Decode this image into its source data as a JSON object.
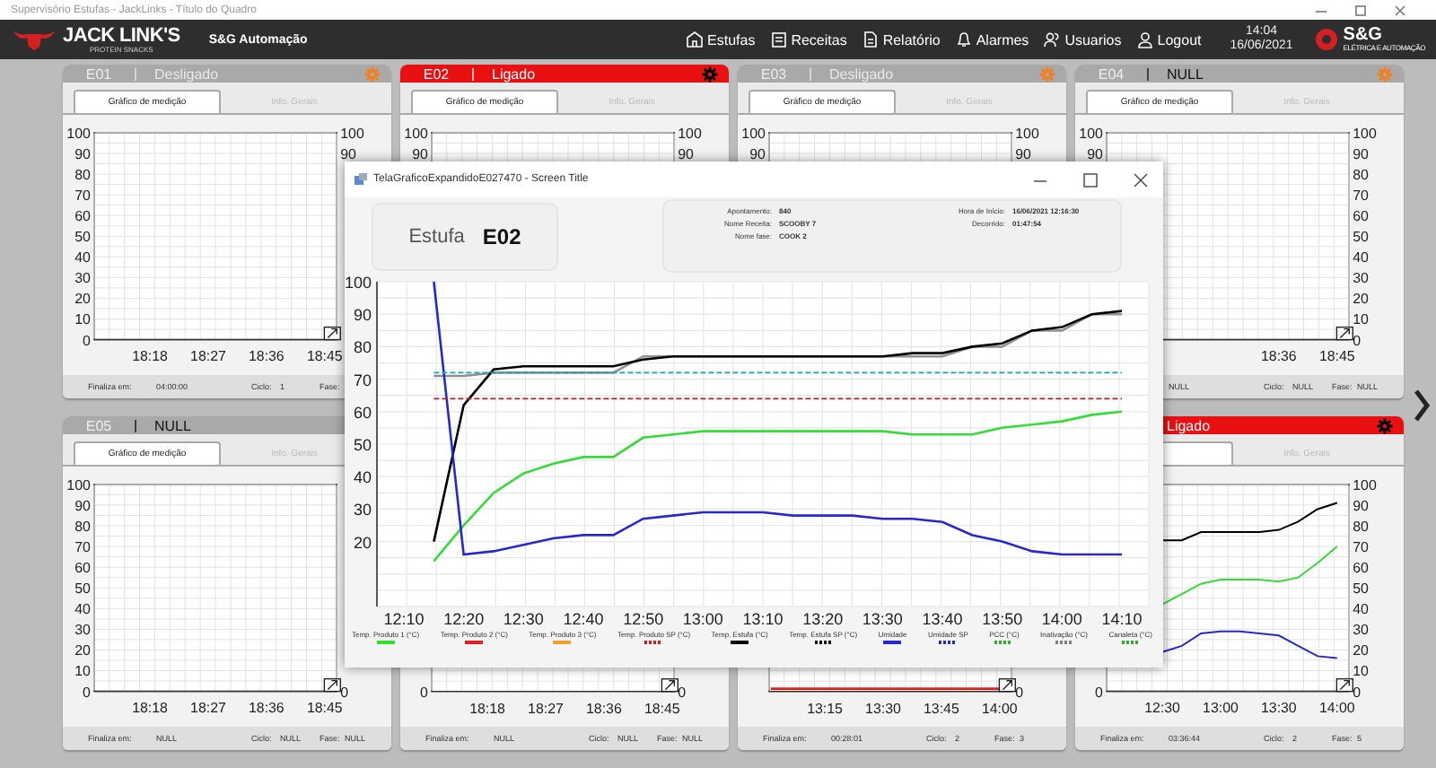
{
  "title_bar": {
    "title": "Supervisório Estufas - JackLinks - Título do Quadro"
  },
  "header": {
    "brand": "JACK LINK'S",
    "brand_tagline": "PROTEIN SNACKS",
    "company": "S&G Automação",
    "nav": [
      {
        "label": "Estufas"
      },
      {
        "label": "Receitas"
      },
      {
        "label": "Relatório"
      },
      {
        "label": "Alarmes"
      },
      {
        "label": "Usuarios"
      },
      {
        "label": "Logout"
      }
    ],
    "time": "14:04",
    "date": "16/06/2021",
    "partner": "S&G",
    "partner_tagline": "ELÉTRICA E AUTOMAÇÃO"
  },
  "cards": [
    {
      "code": "E01",
      "status": "Desligado",
      "kind": "off",
      "settings_icon": true,
      "tabs": [
        {
          "label": "Gráfico de medição",
          "selected": true
        },
        {
          "label": "Info. Gerais",
          "selected": false
        }
      ],
      "left_axis": {
        "upper_labels": [
          "100",
          "90",
          "80",
          "70",
          "60",
          "50",
          "40",
          "30",
          "20",
          "10",
          "0"
        ]
      },
      "right_axis": {
        "upper_labels": [
          "100",
          "90"
        ]
      },
      "x_labels": [
        "18:18",
        "18:27",
        "18:36",
        "18:45"
      ],
      "footer": {
        "finaliza_label": "Finaliza em:",
        "finaliza": "04:00:00",
        "ciclo_label": "Ciclo:",
        "ciclo": "1",
        "fase_label": "Fase:"
      }
    },
    {
      "code": "E02",
      "status": "Ligado",
      "kind": "on",
      "settings_icon": true,
      "tabs": [
        {
          "label": "Gráfico de medição",
          "selected": true
        },
        {
          "label": "Info. Gerais",
          "selected": false
        }
      ],
      "left_axis": {
        "upper_labels": [
          "100",
          "90"
        ]
      },
      "right_axis": {
        "upper_labels": [
          "100",
          "90"
        ]
      }
    },
    {
      "code": "E03",
      "status": "Desligado",
      "kind": "off",
      "settings_icon": true,
      "tabs": [
        {
          "label": "Gráfico de medição",
          "selected": true
        },
        {
          "label": "Info. Gerais",
          "selected": false
        }
      ],
      "left_axis": {
        "upper_labels": [
          "100",
          "90"
        ]
      },
      "right_axis": {
        "upper_labels": [
          "100",
          "90"
        ]
      }
    },
    {
      "code": "E04",
      "status": "NULL",
      "kind": "null",
      "settings_icon": true,
      "tabs": [
        {
          "label": "Gráfico de medição",
          "selected": true
        },
        {
          "label": "Info. Gerais",
          "selected": false
        }
      ],
      "left_axis": {
        "upper_labels": [
          "100",
          "90"
        ]
      },
      "right_axis": {
        "upper_labels": [
          "100",
          "90",
          "80",
          "70",
          "60",
          "50",
          "40",
          "30",
          "20",
          "10",
          "0"
        ]
      },
      "x_labels": [
        "18:36",
        "18:45"
      ],
      "footer": {
        "finaliza": "NULL",
        "ciclo_label": "Ciclo:",
        "ciclo": "NULL",
        "fase_label": "Fase:",
        "fase": "NULL"
      }
    },
    {
      "code": "E05",
      "status": "NULL",
      "kind": "null",
      "tabs": [
        {
          "label": "Gráfico de medição",
          "selected": true
        },
        {
          "label": "Info. Gerais",
          "selected": false
        }
      ],
      "left_axis": {
        "upper_labels": [
          "100",
          "90",
          "80",
          "70",
          "60",
          "50",
          "40",
          "30",
          "20",
          "10",
          "0"
        ]
      },
      "right_axis": {
        "lower_labels": [
          "0"
        ]
      },
      "x_labels": [
        "18:18",
        "18:27",
        "18:36",
        "18:45"
      ],
      "footer": {
        "finaliza_label": "Finaliza em:",
        "finaliza": "NULL",
        "ciclo_label": "Ciclo:",
        "ciclo": "NULL",
        "fase_label": "Fase:",
        "fase": "NULL"
      }
    },
    {
      "left_axis": {
        "lower_labels": [
          "0"
        ]
      },
      "right_axis": {
        "lower_labels": [
          "0"
        ]
      },
      "x_labels": [
        "18:18",
        "18:27",
        "18:36",
        "18:45"
      ],
      "footer": {
        "finaliza_label": "Finaliza em:",
        "finaliza": "NULL",
        "ciclo_label": "Ciclo:",
        "ciclo": "NULL",
        "fase_label": "Fase:",
        "fase": "NULL"
      }
    },
    {
      "zero_line": true,
      "right_axis": {
        "lower_labels": [
          "0"
        ]
      },
      "x_labels": [
        "13:15",
        "13:30",
        "13:45",
        "14:00"
      ],
      "footer": {
        "finaliza_label": "Finaliza em:",
        "finaliza": "00:28:01",
        "ciclo_label": "Ciclo:",
        "ciclo": "2",
        "fase_label": "Fase:",
        "fase": "3"
      }
    },
    {
      "status": "Ligado",
      "kind": "on",
      "settings_icon": true,
      "tabs": [
        {
          "selected": true
        },
        {
          "label": "Info. Gerais",
          "selected": false
        }
      ],
      "left_axis": {
        "lower_labels": [
          "0"
        ]
      },
      "chart_data": {
        "type": "line",
        "grid": true,
        "ylim": [
          0,
          100
        ],
        "yticks": [
          100,
          90,
          80,
          70,
          60,
          50,
          40,
          30,
          20,
          10,
          0
        ],
        "categories": [
          null,
          null,
          "12:30",
          null,
          null,
          "13:00",
          null,
          null,
          "13:30",
          null,
          null,
          "14:00"
        ],
        "series": [
          {
            "color": "#000000",
            "line_style": "solid",
            "values": [
              null,
              null,
              73,
              73,
              77,
              77,
              77,
              77,
              78,
              82,
              88,
              91
            ]
          },
          {
            "color": "#33dd33",
            "line_style": "solid",
            "values": [
              null,
              null,
              42,
              47,
              52,
              54,
              54,
              54,
              53,
              55,
              62,
              70
            ]
          },
          {
            "color": "#2828d0",
            "line_style": "solid",
            "values": [
              null,
              null,
              19,
              22,
              28,
              29,
              29,
              28,
              27,
              22,
              17,
              16
            ]
          }
        ]
      },
      "footer": {
        "finaliza_label": "Finaliza em:",
        "finaliza": "03:36:44",
        "ciclo_label": "Ciclo:",
        "ciclo": "2",
        "fase_label": "Fase:",
        "fase": "5"
      }
    }
  ],
  "dialog": {
    "title": "TelaGraficoExpandidoE027470 - Screen Title",
    "estufa_label": "Estufa",
    "estufa_code": "E02",
    "info": [
      {
        "label": "Apontamento:",
        "value": "840"
      },
      {
        "label": "Nome Receita:",
        "value": "SCOOBY 7"
      },
      {
        "label": "Nome fase:",
        "value": "COOK 2"
      },
      {
        "label": "Hora de Início:",
        "value": "16/06/2021 12:16:30"
      },
      {
        "label": "Decorrido:",
        "value": "01:47:54"
      }
    ],
    "chart_data": {
      "type": "line",
      "grid": true,
      "ylim": [
        0,
        100
      ],
      "yticks": [
        20,
        30,
        40,
        50,
        60,
        70,
        80,
        90,
        100
      ],
      "categories": [
        "12:10",
        null,
        "12:20",
        null,
        "12:30",
        null,
        "12:40",
        null,
        "12:50",
        null,
        "13:00",
        null,
        "13:10",
        null,
        "13:20",
        null,
        "13:30",
        null,
        "13:40",
        null,
        "13:50",
        null,
        "14:00",
        null,
        "14:10"
      ],
      "series": [
        {
          "color": "#909090",
          "line_style": "solid",
          "values": [
            null,
            71,
            71,
            72,
            72,
            72,
            72,
            72,
            77,
            77,
            77,
            77,
            77,
            77,
            77,
            77,
            77,
            77,
            77,
            80,
            80,
            85,
            85,
            90,
            90
          ]
        },
        {
          "color": "#000000",
          "line_style": "solid",
          "values": [
            null,
            20,
            62,
            73,
            74,
            74,
            74,
            74,
            76,
            77,
            77,
            77,
            77,
            77,
            77,
            77,
            77,
            78,
            78,
            80,
            81,
            85,
            86,
            90,
            91
          ]
        },
        {
          "color": "#33dd33",
          "line_style": "solid",
          "values": [
            null,
            14,
            25,
            35,
            41,
            44,
            46,
            46,
            52,
            53,
            54,
            54,
            54,
            54,
            54,
            54,
            54,
            53,
            53,
            53,
            55,
            56,
            57,
            59,
            60
          ]
        },
        {
          "color": "#2828d0",
          "line_style": "solid",
          "values": [
            null,
            100,
            16,
            17,
            19,
            21,
            22,
            22,
            27,
            28,
            29,
            29,
            29,
            28,
            28,
            28,
            27,
            27,
            26,
            22,
            20,
            17,
            16,
            16,
            16
          ]
        },
        {
          "color": "#c02020",
          "line_style": "dashed",
          "values": [
            null,
            64,
            64,
            64,
            64,
            64,
            64,
            64,
            64,
            64,
            64,
            64,
            64,
            64,
            64,
            64,
            64,
            64,
            64,
            64,
            64,
            64,
            64,
            64,
            64
          ]
        },
        {
          "color": "#20a0b0",
          "line_style": "dashed",
          "values": [
            null,
            72,
            72,
            72,
            72,
            72,
            72,
            72,
            72,
            72,
            72,
            72,
            72,
            72,
            72,
            72,
            72,
            72,
            72,
            72,
            72,
            72,
            72,
            72,
            72
          ]
        }
      ]
    },
    "legend": [
      {
        "label": "Temp. Produto 1 (°C)",
        "color": "#33dd33",
        "dotted": false
      },
      {
        "label": "Temp. Produto 2 (°C)",
        "color": "#e02020",
        "dotted": false
      },
      {
        "label": "Temp. Produto 3 (°C)",
        "color": "#f0a030",
        "dotted": false
      },
      {
        "label": "Temp. Produto SP (°C)",
        "color": "#c02020",
        "dotted": true
      },
      {
        "label": "Temp. Estufa (°C)",
        "color": "#000000",
        "dotted": false
      },
      {
        "label": "Temp. Estufa SP (°C)",
        "color": "#000000",
        "dotted": true
      },
      {
        "label": "Umidade",
        "color": "#2828d0",
        "dotted": false
      },
      {
        "label": "Umidade SP",
        "color": "#2828d0",
        "dotted": true
      },
      {
        "label": "PCC (°C)",
        "color": "#33aa33",
        "dotted": true
      },
      {
        "label": "Inativação (°C)",
        "color": "#808080",
        "dotted": true
      },
      {
        "label": "Canaleta (°C)",
        "color": "#33aa33",
        "dotted": true
      }
    ]
  }
}
